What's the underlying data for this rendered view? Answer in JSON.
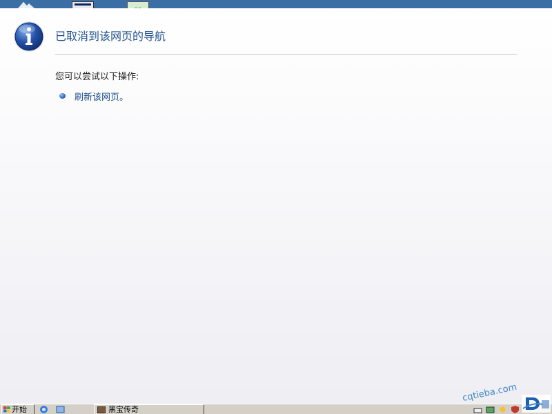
{
  "page": {
    "title": "已取消到该网页的导航",
    "subtitle": "您可以尝试以下操作:",
    "actions": [
      {
        "label": "刷新该网页。"
      }
    ]
  },
  "taskbar": {
    "start_label": "开始",
    "task_label": "黑宝传奇"
  },
  "watermark": {
    "text": "cqtieba.com"
  },
  "colors": {
    "title": "#1f4f8a",
    "link": "#1f4f8a",
    "icon_blue": "#1d4fa3",
    "desktop": "#3a6ea5",
    "taskbar": "#d4d0c8"
  },
  "icons": {
    "info": "info-icon",
    "bullet": "bullet-icon"
  }
}
